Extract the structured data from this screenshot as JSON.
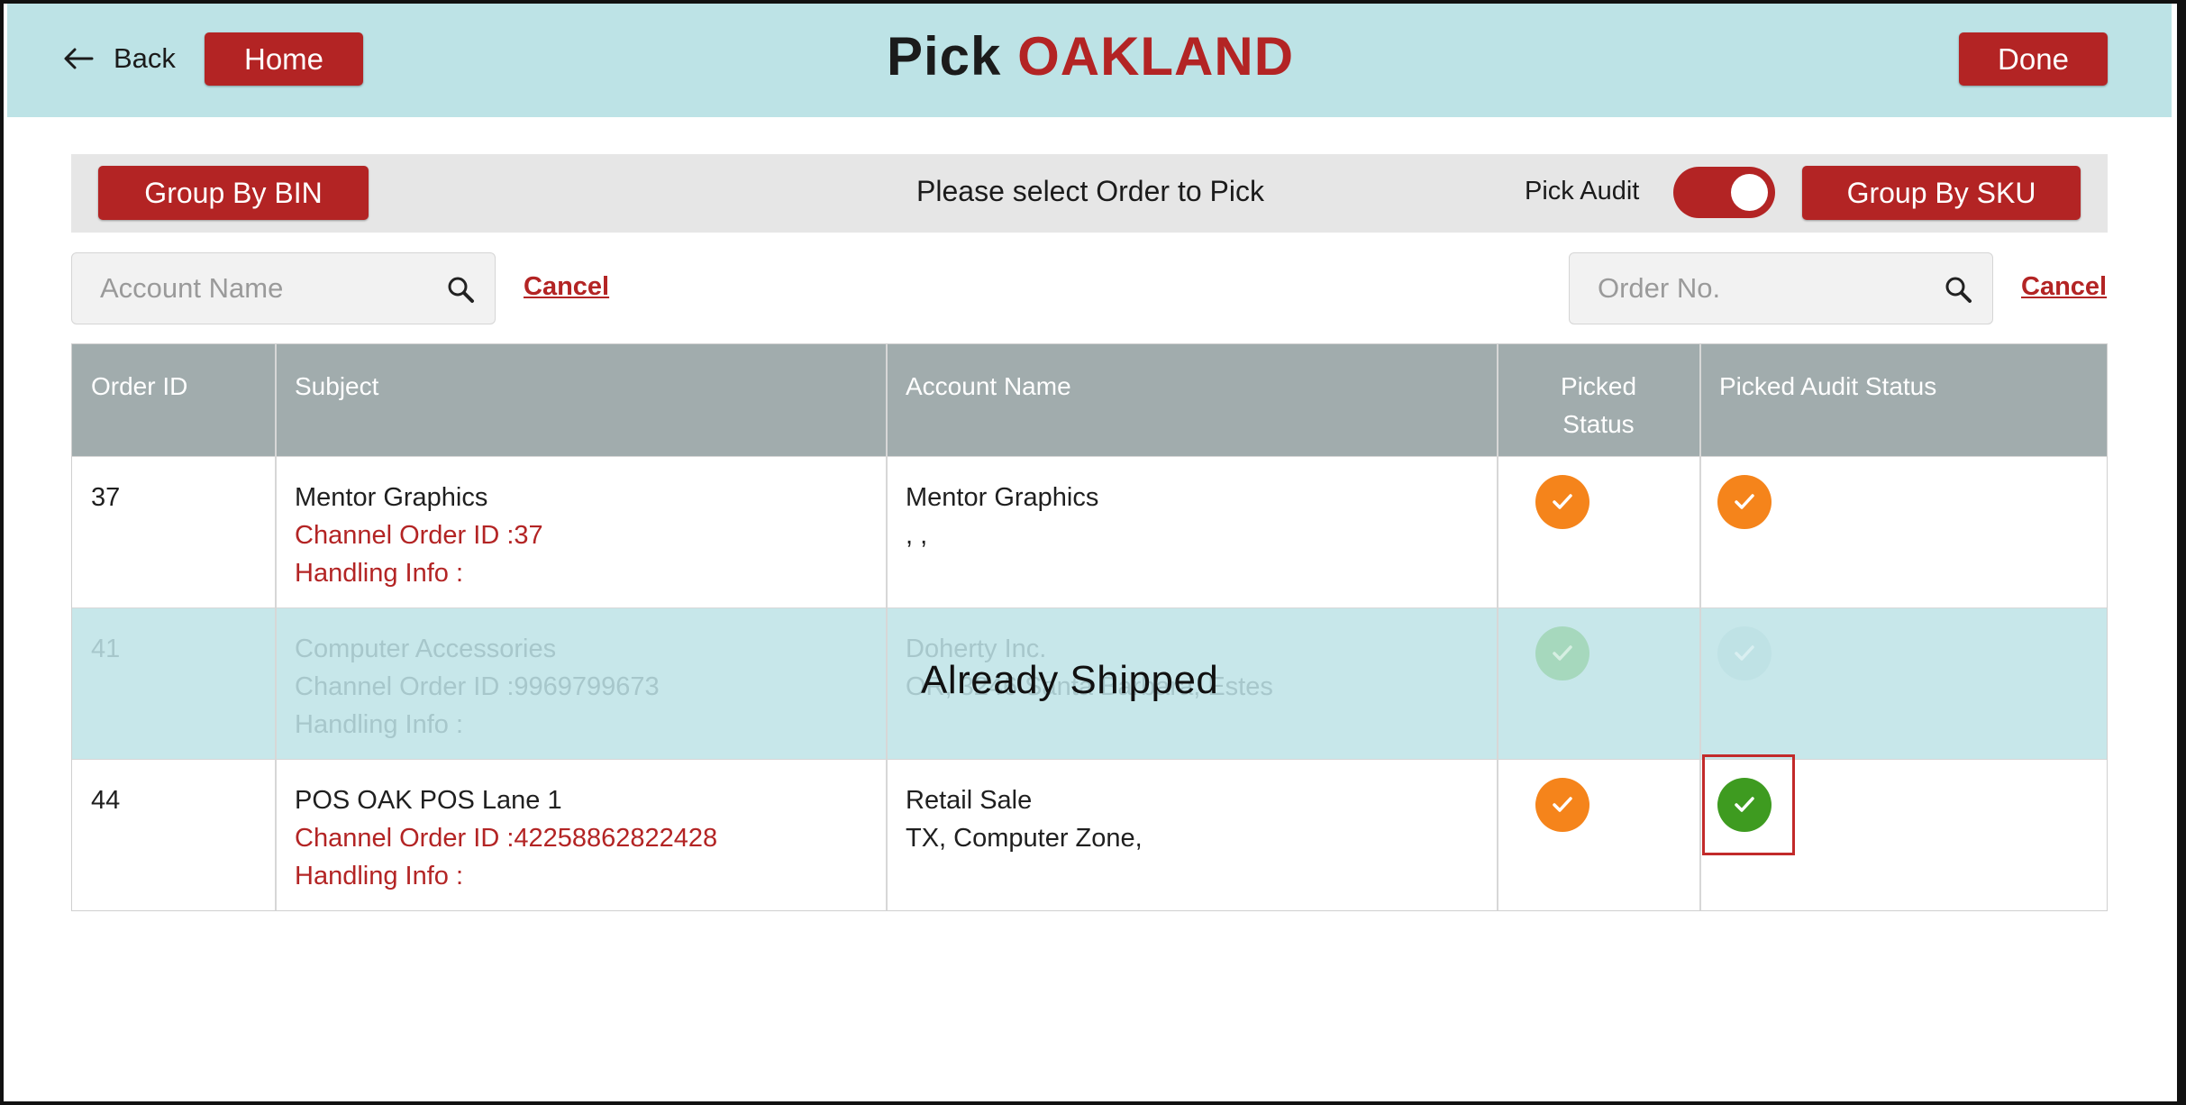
{
  "header": {
    "back_label": "Back",
    "home_label": "Home",
    "title_prefix": "Pick",
    "title_location": "OAKLAND",
    "done_label": "Done"
  },
  "toolbar": {
    "group_by_bin_label": "Group By BIN",
    "message": "Please select Order to Pick",
    "pick_audit_label": "Pick Audit",
    "pick_audit_on": true,
    "group_by_sku_label": "Group By SKU"
  },
  "search": {
    "account_placeholder": "Account Name",
    "order_placeholder": "Order No.",
    "cancel_label": "Cancel"
  },
  "table": {
    "headers": {
      "order_id": "Order ID",
      "subject": "Subject",
      "account_name": "Account Name",
      "picked_status_line1": "Picked",
      "picked_status_line2": "Status",
      "picked_audit_status": "Picked Audit Status"
    },
    "rows": [
      {
        "order_id": "37",
        "subject": "Mentor Graphics",
        "channel_order": "Channel Order ID :37",
        "handling": "Handling Info :",
        "account": "Mentor Graphics",
        "address": ", ,",
        "picked_status": "check-orange",
        "audit_status": "check-orange"
      },
      {
        "order_id": "41",
        "subject": "Computer Accessories",
        "channel_order": "Channel Order ID :9969799673",
        "handling": "Handling Info :",
        "account": "Doherty Inc.",
        "address": "OR, 3246 Santa Barbara, Estes",
        "picked_status": "check-green-faded",
        "audit_status": "check-teal-faded",
        "overlay": "Already Shipped"
      },
      {
        "order_id": "44",
        "subject": "POS OAK POS Lane 1",
        "channel_order": "Channel Order ID :42258862822428",
        "handling": "Handling Info :",
        "account": "Retail Sale",
        "address": "TX, Computer Zone,",
        "picked_status": "check-orange",
        "audit_status": "check-green"
      }
    ]
  },
  "colors": {
    "brand_red": "#b32424",
    "header_bg": "#bde3e6",
    "shipped_row_bg": "#c7e7ea",
    "table_header_bg": "#a1acad",
    "status_orange": "#f5841b",
    "status_green": "#3e9b20"
  }
}
